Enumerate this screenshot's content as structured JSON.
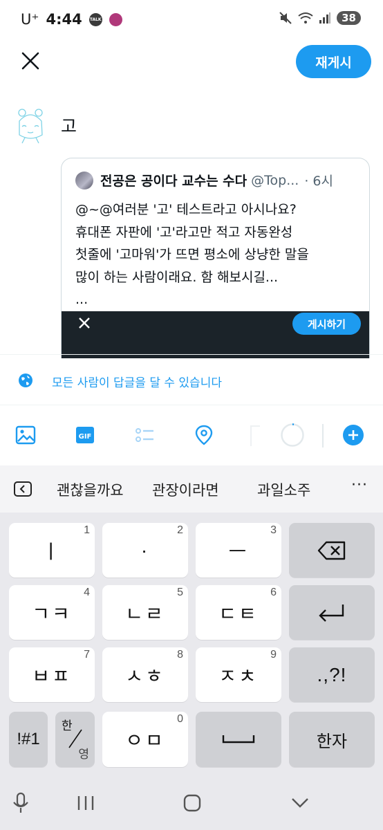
{
  "status_bar": {
    "carrier": "U⁺",
    "time": "4:44",
    "badge1": "TALK",
    "badge2": "Kakao Bank",
    "battery": "38"
  },
  "header": {
    "close_icon": "close-icon",
    "repost_label": "재게시"
  },
  "compose": {
    "text": "고"
  },
  "quote": {
    "author_name": "전공은 공이다 교수는 수다",
    "handle": "@Top...",
    "time": "· 6시",
    "lines": [
      "@~@여러분 '고' 테스트라고 아시나요?",
      "휴대폰 자판에 '고'라고만 적고 자동완성",
      "첫줄에 '고마워'가 뜨면 평소에 상냥한 말을",
      "많이 하는 사람이래요. 함 해보시길...",
      "..."
    ],
    "post_button": "게시하기"
  },
  "reply_setting": {
    "label": "모든 사람이 답글을 달 수 있습니다"
  },
  "toolbar": {
    "icons": [
      "image-icon",
      "gif-icon",
      "poll-icon",
      "location-icon",
      "progress-ring-icon",
      "add-post-icon"
    ]
  },
  "suggestions": {
    "items": [
      "괜찮을까요",
      "관장이라면",
      "과일소주"
    ],
    "more": "···"
  },
  "keyboard": {
    "row1": [
      {
        "label": "ㅣ",
        "num": "1"
      },
      {
        "label": "·",
        "num": "2"
      },
      {
        "label": "ㅡ",
        "num": "3"
      }
    ],
    "row2": [
      {
        "label": "ㄱㅋ",
        "num": "4"
      },
      {
        "label": "ㄴㄹ",
        "num": "5"
      },
      {
        "label": "ㄷㅌ",
        "num": "6"
      }
    ],
    "row3": [
      {
        "label": "ㅂㅍ",
        "num": "7"
      },
      {
        "label": "ㅅㅎ",
        "num": "8"
      },
      {
        "label": "ㅈㅊ",
        "num": "9"
      }
    ],
    "punct": ".,?!",
    "symbols": "!#1",
    "lang_top": "한",
    "lang_bottom": "영",
    "row4_key": {
      "label": "ㅇㅁ",
      "num": "0"
    },
    "hanja": "한자"
  },
  "colors": {
    "accent": "#1d9bf0",
    "dark_bar": "#1b2329"
  }
}
